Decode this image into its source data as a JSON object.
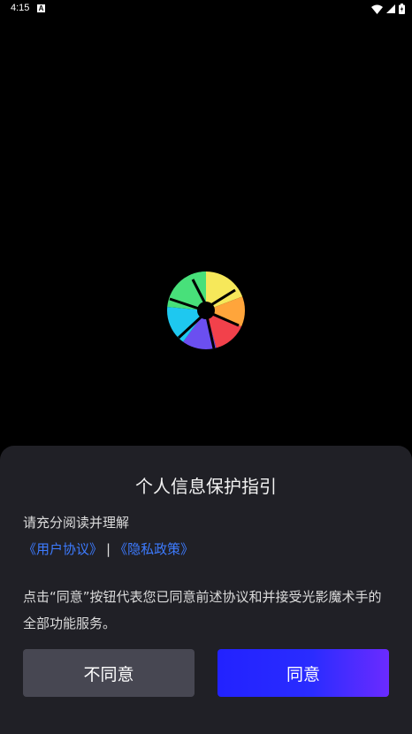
{
  "status_bar": {
    "time": "4:15",
    "notification_glyph": "A",
    "icons": [
      "wifi-icon",
      "signal-icon",
      "battery-icon"
    ]
  },
  "app_logo": {
    "icon": "aperture-logo-icon"
  },
  "dialog": {
    "title": "个人信息保护指引",
    "intro": "请充分阅读并理解",
    "links": {
      "user_agreement": "《用户协议》",
      "separator": "|",
      "privacy_policy": "《隐私政策》"
    },
    "description": "点击“同意”按钮代表您已同意前述协议和并接受光影魔术手的全部功能服务。",
    "buttons": {
      "disagree": "不同意",
      "agree": "同意"
    }
  },
  "colors": {
    "background": "#000000",
    "sheet": "#202026",
    "link": "#3d7bff",
    "disagree_button": "#474752",
    "agree_button_start": "#2222ff",
    "agree_button_end": "#6b2bff"
  }
}
